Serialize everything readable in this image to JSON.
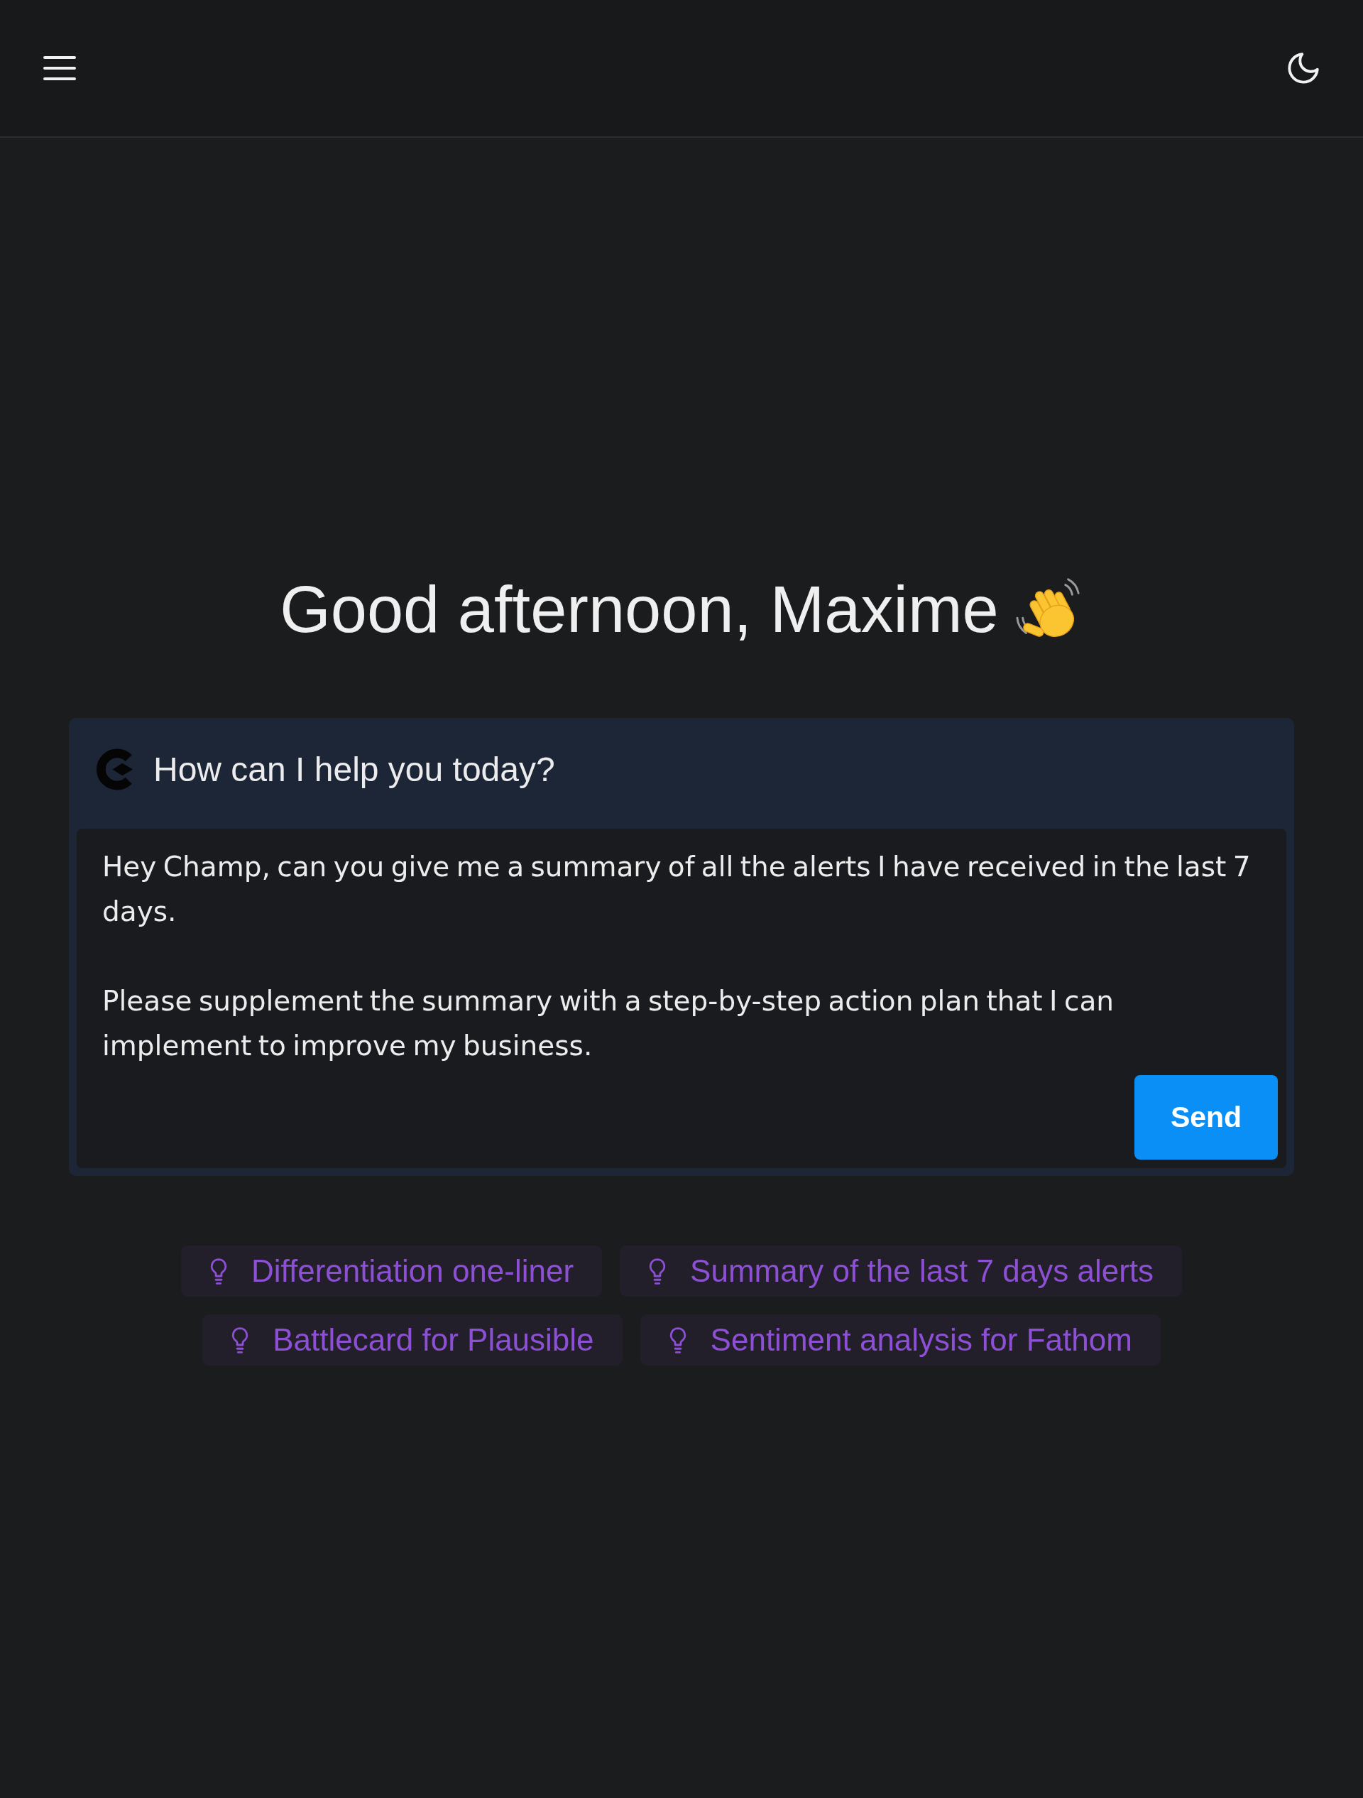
{
  "greeting": "Good afternoon, Maxime",
  "assistant_card": {
    "title": "How can I help you today?",
    "message_field": {
      "value": "Hey Champ, can you give me a summary of all the alerts I have received in the last 7 days.\n\nPlease supplement the summary with a step-by-step action plan that I can implement to improve my business."
    },
    "send_button": "Send"
  },
  "suggestions": [
    {
      "label": "Differentiation one-liner"
    },
    {
      "label": "Summary of the last 7 days alerts"
    },
    {
      "label": "Battlecard for Plausible"
    },
    {
      "label": "Sentiment analysis for Fathom"
    }
  ]
}
